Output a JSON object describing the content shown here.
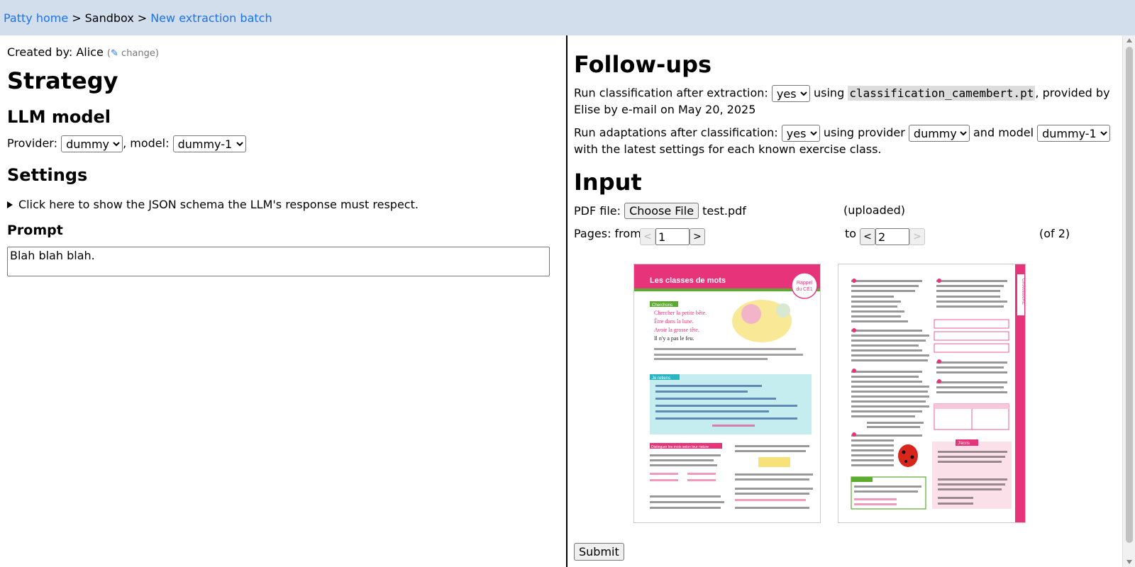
{
  "breadcrumb": {
    "home": "Patty home",
    "sep1": ">",
    "sandbox": "Sandbox",
    "sep2": ">",
    "current": "New extraction batch"
  },
  "left": {
    "created_by_label": "Created by: Alice",
    "change_open": "(",
    "change_label": "change",
    "change_close": ")",
    "strategy_title": "Strategy",
    "llm_title": "LLM model",
    "provider_label": "Provider:",
    "provider_value": "dummy",
    "model_label": ", model:",
    "model_value": "dummy-1",
    "settings_title": "Settings",
    "details_summary": "Click here to show the JSON schema the LLM's response must respect.",
    "prompt_title": "Prompt",
    "prompt_value": "Blah blah blah."
  },
  "right": {
    "followups_title": "Follow-ups",
    "classif_label": "Run classification after extraction:",
    "classif_value": "yes",
    "classif_using": "using",
    "classif_model": "classification_camembert.pt",
    "classif_suffix": ", provided by Elise by e-mail on May 20, 2025",
    "adapt_label": "Run adaptations after classification:",
    "adapt_value": "yes",
    "adapt_provider_label": "using provider",
    "adapt_provider_value": "dummy",
    "adapt_model_label": "and model",
    "adapt_model_value": "dummy-1",
    "adapt_suffix": "with the latest settings for each known exercise class.",
    "input_title": "Input",
    "pdf_label": "PDF file:",
    "choose_file_label": "Choose File",
    "file_name": "test.pdf",
    "uploaded_label": "(uploaded)",
    "pages_from_label": "Pages: from",
    "prev_label": "<",
    "next_label": ">",
    "page_from": "1",
    "to_label": "to",
    "page_to": "2",
    "of_label": "(of 2)",
    "submit_label": "Submit"
  },
  "pdf_left": {
    "header": "Les classes de mots",
    "badge_line1": "Rappel",
    "badge_line2": "du CE1",
    "cherchons": "Cherchons",
    "line1": "Chercher la petite bête.",
    "line2": "Être dans la lune.",
    "line3": "Avoir la grosse tête.",
    "line4": "Il n'y a pas le feu.",
    "jeretiens": "Je retiens",
    "distinguer": "Distinguer les mots selon leur nature"
  },
  "pdf_right": {
    "side": "GRAMMAIRE",
    "jecris": "J'écris"
  },
  "colors": {
    "topbar": "#d3deed",
    "link": "#1a73e8",
    "pdf_header": "#e6337a",
    "pdf_green": "#5aab2e",
    "pdf_teal": "#2bb5c0"
  }
}
